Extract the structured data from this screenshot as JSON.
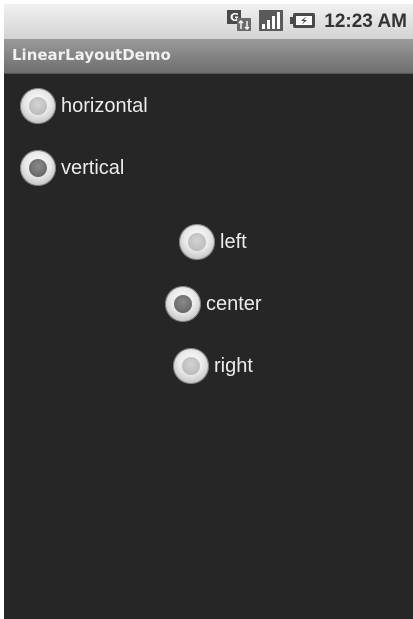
{
  "status_bar": {
    "time": "12:23 AM",
    "icons": [
      "network-type-icon",
      "signal-icon",
      "battery-icon"
    ]
  },
  "app": {
    "title": "LinearLayoutDemo"
  },
  "orientation_group": {
    "options": [
      {
        "label": "horizontal",
        "checked": false
      },
      {
        "label": "vertical",
        "checked": true
      }
    ]
  },
  "gravity_group": {
    "options": [
      {
        "label": "left",
        "checked": false
      },
      {
        "label": "center",
        "checked": true
      },
      {
        "label": "right",
        "checked": false
      }
    ]
  },
  "colors": {
    "background": "#262626",
    "status_bar": "#dcdcdc",
    "title_bar": "#848484",
    "label_text": "#ececec"
  }
}
